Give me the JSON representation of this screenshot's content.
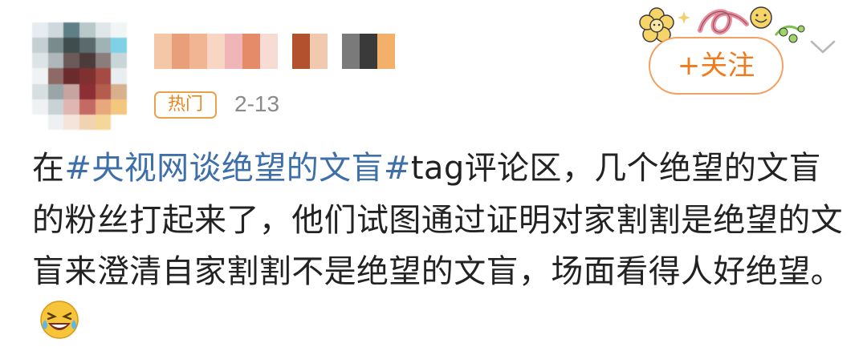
{
  "post": {
    "badge": "热门",
    "date": "2-13",
    "follow_label": "+关注",
    "content": {
      "prefix": "在",
      "hashtag": "#央视网谈绝望的文盲#",
      "body": "tag评论区，几个绝望的文盲的粉丝打起来了，他们试图通过证明对家割割是绝望的文盲来澄清自家割割不是绝望的文盲，场面看得人好绝望。"
    },
    "emoji": "laughing-crying-face"
  },
  "colors": {
    "accent": "#f07a1c",
    "hashtag": "#3e6fa8",
    "badge_border": "#e8a24a",
    "date": "#8a8a8a"
  },
  "icons": [
    "avatar",
    "decoration-flowers-sticker",
    "chevron-down-icon",
    "laughing-crying-emoji"
  ]
}
